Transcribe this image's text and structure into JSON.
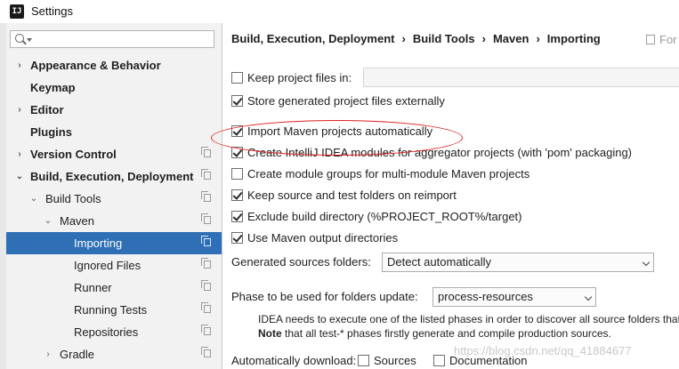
{
  "window": {
    "title": "Settings",
    "app_icon_text": "IJ"
  },
  "sidebar": {
    "search_placeholder": "",
    "items": [
      {
        "label": "Appearance & Behavior",
        "bold": true,
        "arrow": "›",
        "indent": 0
      },
      {
        "label": "Keymap",
        "bold": true,
        "arrow": "",
        "indent": 0
      },
      {
        "label": "Editor",
        "bold": true,
        "arrow": "›",
        "indent": 0
      },
      {
        "label": "Plugins",
        "bold": true,
        "arrow": "",
        "indent": 0
      },
      {
        "label": "Version Control",
        "bold": true,
        "arrow": "›",
        "indent": 0
      },
      {
        "label": "Build, Execution, Deployment",
        "bold": true,
        "arrow": "⌄",
        "indent": 0
      },
      {
        "label": "Build Tools",
        "bold": false,
        "arrow": "⌄",
        "indent": 1
      },
      {
        "label": "Maven",
        "bold": false,
        "arrow": "⌄",
        "indent": 2
      },
      {
        "label": "Importing",
        "bold": false,
        "arrow": "",
        "indent": 3,
        "selected": true
      },
      {
        "label": "Ignored Files",
        "bold": false,
        "arrow": "",
        "indent": 3
      },
      {
        "label": "Runner",
        "bold": false,
        "arrow": "",
        "indent": 3
      },
      {
        "label": "Running Tests",
        "bold": false,
        "arrow": "",
        "indent": 3
      },
      {
        "label": "Repositories",
        "bold": false,
        "arrow": "",
        "indent": 3
      },
      {
        "label": "Gradle",
        "bold": false,
        "arrow": "›",
        "indent": 2
      }
    ]
  },
  "breadcrumb": {
    "parts": [
      "Build, Execution, Deployment",
      "Build Tools",
      "Maven",
      "Importing"
    ],
    "separator": "›",
    "for_project": "For"
  },
  "options": [
    {
      "label": "Keep project files in:",
      "checked": false
    },
    {
      "label": "Store generated project files externally",
      "checked": true
    },
    {
      "label": "Import Maven projects automatically",
      "checked": true
    },
    {
      "label": "Create IntelliJ IDEA modules for aggregator projects (with 'pom' packaging)",
      "checked": true
    },
    {
      "label": "Create module groups for multi-module Maven projects",
      "checked": false
    },
    {
      "label": "Keep source and test folders on reimport",
      "checked": true
    },
    {
      "label": "Exclude build directory (%PROJECT_ROOT%/target)",
      "checked": true
    },
    {
      "label": "Use Maven output directories",
      "checked": true
    }
  ],
  "generated_sources": {
    "label": "Generated sources folders:",
    "value": "Detect automatically"
  },
  "phase": {
    "label": "Phase to be used for folders update:",
    "value": "process-resources"
  },
  "note": {
    "line1": "IDEA needs to execute one of the listed phases in order to discover all source folders that a",
    "line2_bold": "Note",
    "line2_rest": " that all test-* phases firstly generate and compile production sources."
  },
  "auto_download": {
    "label": "Automatically download:",
    "sources": "Sources",
    "sources_checked": false,
    "documentation": "Documentation",
    "documentation_checked": false
  },
  "watermark": "https://blog.csdn.net/qq_41884677",
  "colors": {
    "selection": "#2f6fb5",
    "annotation": "#e02020"
  }
}
